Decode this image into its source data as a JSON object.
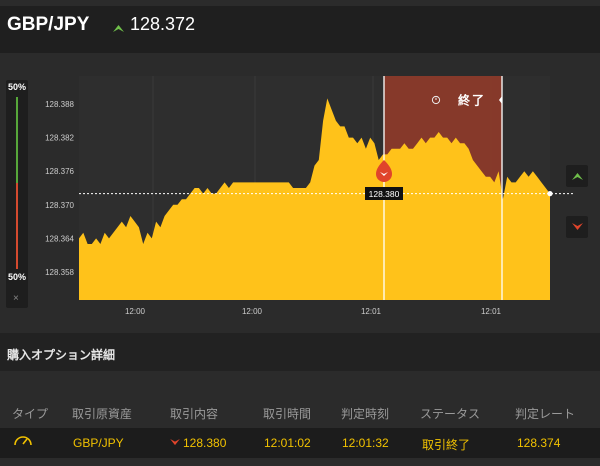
{
  "header": {
    "pair": "GBP/JPY",
    "price": "128.372",
    "trend_icon": "up-arrow-icon"
  },
  "indicator": {
    "top_pct": "50%",
    "bottom_pct": "50%",
    "close_label": "×"
  },
  "chart": {
    "y_ticks": [
      "128.388",
      "128.382",
      "128.376",
      "128.370",
      "128.364",
      "128.358"
    ],
    "x_ticks": [
      "12:00",
      "12:00",
      "12:01",
      "12:01"
    ],
    "end_label": "終了",
    "marker_price": "128.380",
    "colors": {
      "area": "#ffc21a",
      "expiry_zone": "#8b3a2a",
      "up": "#6fbf4a",
      "down": "#e0442b"
    }
  },
  "chart_data": {
    "type": "area",
    "y_ticks": [
      128.358,
      128.364,
      128.37,
      128.376,
      128.382,
      128.388
    ],
    "ylim": [
      128.353,
      128.393
    ],
    "series": [
      {
        "values": [
          128.364,
          128.365,
          128.363,
          128.363,
          128.364,
          128.363,
          128.365,
          128.364,
          128.365,
          128.366,
          128.367,
          128.366,
          128.368,
          128.367,
          128.366,
          128.363,
          128.365,
          128.364,
          128.367,
          128.366,
          128.368,
          128.369,
          128.37,
          128.37,
          128.371,
          128.371,
          128.372,
          128.373,
          128.373,
          128.372,
          128.373,
          128.372,
          128.372,
          128.373,
          128.374,
          128.373,
          128.374,
          128.374,
          128.374,
          128.374,
          128.374,
          128.374,
          128.374,
          128.374,
          128.374,
          128.374,
          128.374,
          128.374,
          128.374,
          128.374,
          128.373,
          128.373,
          128.373,
          128.373,
          128.374,
          128.377,
          128.378,
          128.385,
          128.389,
          128.387,
          128.385,
          128.384,
          128.384,
          128.382,
          128.382,
          128.381,
          128.382,
          128.38,
          128.382,
          128.381,
          128.378,
          128.379,
          128.379,
          128.38,
          128.38,
          128.38,
          128.381,
          128.38,
          128.38,
          128.381,
          128.382,
          128.381,
          128.382,
          128.382,
          128.383,
          128.382,
          128.382,
          128.381,
          128.382,
          128.381,
          128.381,
          128.38,
          128.378,
          128.377,
          128.376,
          128.375,
          128.375,
          128.374,
          128.376,
          128.371,
          128.375,
          128.374,
          128.374,
          128.375,
          128.376,
          128.375,
          128.376,
          128.375,
          128.374,
          128.373,
          128.372
        ]
      }
    ],
    "current_price": 128.372,
    "entry_price": 128.38
  },
  "details": {
    "title": "購入オプション詳細",
    "columns": [
      "タイプ",
      "取引原資産",
      "取引内容",
      "取引時間",
      "判定時刻",
      "ステータス",
      "判定レート"
    ],
    "row": {
      "type_icon": "gauge-icon",
      "asset": "GBP/JPY",
      "direction_icon": "down-arrow-icon",
      "content": "128.380",
      "trade_time": "12:01:02",
      "judge_time": "12:01:32",
      "status": "取引終了",
      "rate": "128.374"
    }
  }
}
